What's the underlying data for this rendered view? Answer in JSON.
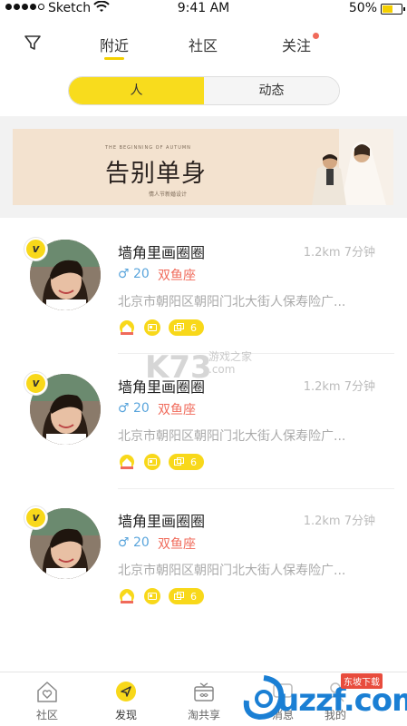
{
  "status_bar": {
    "carrier": "Sketch",
    "time": "9:41 AM",
    "battery": "50%"
  },
  "top_nav": {
    "tabs": [
      "附近",
      "社区",
      "关注"
    ]
  },
  "segment": {
    "people": "人",
    "moments": "动态"
  },
  "banner": {
    "subtitle": "THE BEGINNING OF AUTUMN",
    "title": "告别单身",
    "tagline": "情人节新婚设计"
  },
  "users": [
    {
      "name": "墙角里画圈圈",
      "distance_time": "1.2km 7分钟",
      "age": "♂ 20",
      "zodiac": "双鱼座",
      "address": "北京市朝阳区朝阳门北大街人保寿险广...",
      "count": "6"
    },
    {
      "name": "墙角里画圈圈",
      "distance_time": "1.2km 7分钟",
      "age": "♂ 20",
      "zodiac": "双鱼座",
      "address": "北京市朝阳区朝阳门北大街人保寿险广...",
      "count": "6"
    },
    {
      "name": "墙角里画圈圈",
      "distance_time": "1.2km 7分钟",
      "age": "♂ 20",
      "zodiac": "双鱼座",
      "address": "北京市朝阳区朝阳门北大街人保寿险广...",
      "count": "6"
    }
  ],
  "watermarks": {
    "k73": "K73",
    "k73_sub1": "游戏之家",
    "k73_sub2": ".com",
    "uzzf": "uzzf.com",
    "uzzf_badge": "东坡下载"
  },
  "tab_bar": {
    "items": [
      "社区",
      "发现",
      "淘共享",
      "消息",
      "我的"
    ]
  },
  "colors": {
    "accent": "#f8d81a",
    "gender_blue": "#5aa5dc",
    "zodiac_red": "#f06a5a"
  }
}
